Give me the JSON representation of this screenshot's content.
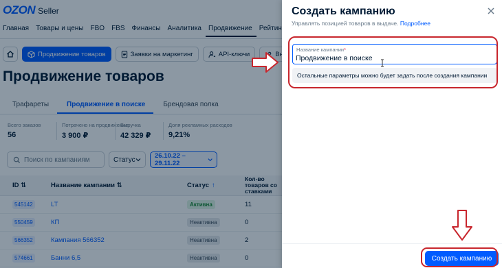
{
  "brand": {
    "logo": "OZON",
    "product": "Seller"
  },
  "nav": [
    "Главная",
    "Товары и цены",
    "FBO",
    "FBS",
    "Финансы",
    "Аналитика",
    "Продвижение",
    "Рейтин"
  ],
  "subnav": {
    "promo_label": "Продвижение товаров",
    "marketing_label": "Заявки на маркетинг",
    "api_label": "API-ключи",
    "external_label": "Внешн"
  },
  "page": {
    "title": "Продвижение товаров"
  },
  "tabs": [
    "Трафареты",
    "Продвижение в поиске",
    "Брендовая полка"
  ],
  "stats": [
    {
      "label": "Всего заказов",
      "value": "56"
    },
    {
      "label": "Потрачено на продвижение",
      "value": "3 900 ₽"
    },
    {
      "label": "Выручка",
      "value": "42 329 ₽"
    },
    {
      "label": "Доля рекламных расходов",
      "value": "9,21%"
    }
  ],
  "filters": {
    "search_placeholder": "Поиск по кампаниям",
    "status_label": "Статус",
    "date_range": "26.10.22 – 29.11.22"
  },
  "table": {
    "headers": {
      "id": "ID",
      "name": "Название кампании",
      "status": "Статус",
      "count": "Кол-во товаров со ставками"
    },
    "rows": [
      {
        "id": "545142",
        "name": "LT",
        "status": "Активна",
        "count": "11"
      },
      {
        "id": "550459",
        "name": "КП",
        "status": "Неактивна",
        "count": "0"
      },
      {
        "id": "566352",
        "name": "Кампания 566352",
        "status": "Неактивна",
        "count": "2"
      },
      {
        "id": "574661",
        "name": "Банни 6,5",
        "status": "Неактивна",
        "count": "0"
      }
    ]
  },
  "panel": {
    "title": "Создать кампанию",
    "subtitle": "Управлять позицией товаров в выдаче.",
    "subtitle_link": "Подробнее",
    "field_label": "Название кампании",
    "field_required_mark": "*",
    "field_value": "Продвижение в поиске",
    "hint": "Остальные параметры можно будет задать после создания кампании",
    "submit_label": "Создать кампанию"
  },
  "colors": {
    "accent": "#005bff",
    "annotation": "#c8262d",
    "active_status": "#1a8a37"
  }
}
